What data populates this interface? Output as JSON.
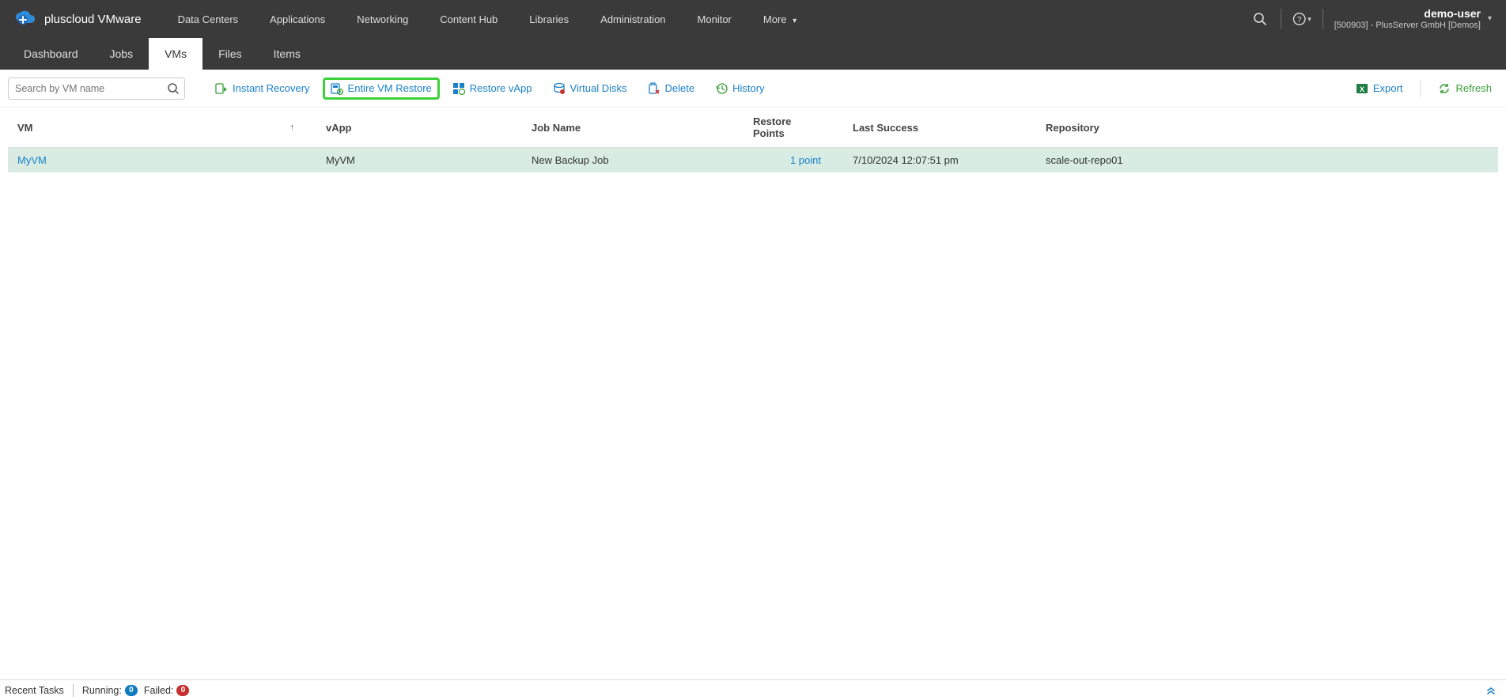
{
  "brand": {
    "name": "pluscloud VMware"
  },
  "topnav": {
    "items": [
      "Data Centers",
      "Applications",
      "Networking",
      "Content Hub",
      "Libraries",
      "Administration",
      "Monitor"
    ],
    "more": "More"
  },
  "user": {
    "name": "demo-user",
    "org": "[500903] - PlusServer GmbH [Demos]"
  },
  "subtabs": {
    "items": [
      "Dashboard",
      "Jobs",
      "VMs",
      "Files",
      "Items"
    ],
    "active": "VMs"
  },
  "toolbar": {
    "search_placeholder": "Search by VM name",
    "instant_recovery": "Instant Recovery",
    "entire_vm_restore": "Entire VM Restore",
    "restore_vapp": "Restore vApp",
    "virtual_disks": "Virtual Disks",
    "delete": "Delete",
    "history": "History",
    "export": "Export",
    "refresh": "Refresh"
  },
  "table": {
    "headers": {
      "vm": "VM",
      "vapp": "vApp",
      "job_name": "Job Name",
      "restore_points": "Restore Points",
      "last_success": "Last Success",
      "repository": "Repository"
    },
    "rows": [
      {
        "vm": "MyVM",
        "vapp": "MyVM",
        "job_name": "New Backup Job",
        "restore_points": "1 point",
        "last_success": "7/10/2024 12:07:51 pm",
        "repository": "scale-out-repo01"
      }
    ]
  },
  "footer": {
    "recent_tasks": "Recent Tasks",
    "running_label": "Running:",
    "running_count": "0",
    "failed_label": "Failed:",
    "failed_count": "0"
  }
}
